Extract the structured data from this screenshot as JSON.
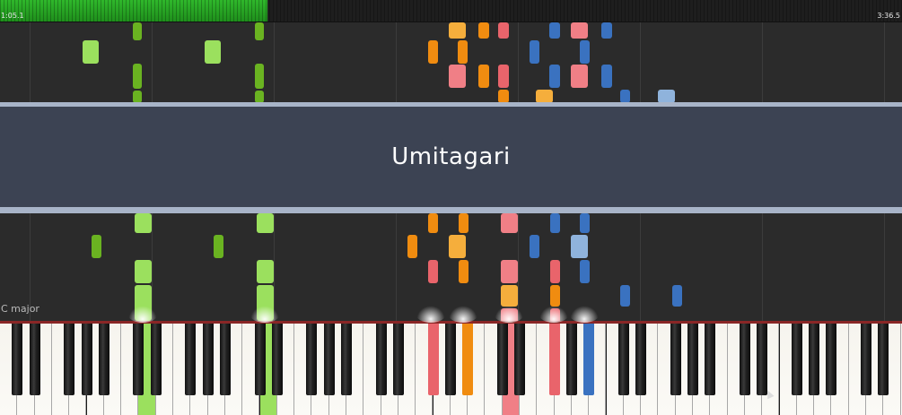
{
  "progress": {
    "elapsed": "1:05.1",
    "total": "3:36.5",
    "fraction": 0.297,
    "color": "#2fb82b"
  },
  "song": {
    "title": "Umitagari"
  },
  "key_signature": "C major",
  "colors": {
    "light_green": "#9be05e",
    "dark_green": "#6ab321",
    "orange": "#f08c10",
    "light_orange": "#f5ae3c",
    "red": "#e9646b",
    "pink": "#f07f86",
    "blue": "#3a72c0",
    "light_blue": "#8fb3dc",
    "piano_rail": "#8a2626"
  },
  "pressed_keys": [
    {
      "name": "green-key-1",
      "color": "light_green"
    },
    {
      "name": "green-key-2",
      "color": "light_green"
    },
    {
      "name": "red-key-1",
      "color": "red"
    },
    {
      "name": "orange-key-1",
      "color": "orange"
    },
    {
      "name": "pink-key-1",
      "color": "pink"
    },
    {
      "name": "red-key-2",
      "color": "red"
    },
    {
      "name": "blue-key-1",
      "color": "blue"
    }
  ]
}
